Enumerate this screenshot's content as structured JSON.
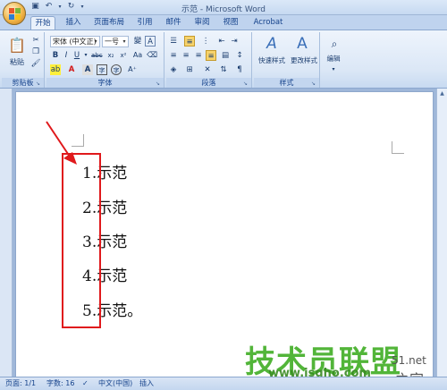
{
  "window": {
    "title": "示范 - Microsoft Word"
  },
  "tabs": [
    {
      "label": "开始",
      "active": true
    },
    {
      "label": "插入"
    },
    {
      "label": "页面布局"
    },
    {
      "label": "引用"
    },
    {
      "label": "邮件"
    },
    {
      "label": "审阅"
    },
    {
      "label": "视图"
    },
    {
      "label": "Acrobat"
    }
  ],
  "ribbon": {
    "clipboard": {
      "paste_label": "粘贴",
      "group_label": "剪贴板"
    },
    "font": {
      "font_name": "宋体 (中文正)",
      "font_size": "一号",
      "group_label": "字体"
    },
    "paragraph": {
      "group_label": "段落"
    },
    "styles": {
      "quick_styles_label": "快速样式",
      "change_styles_label": "更改样式",
      "group_label": "样式"
    },
    "editing": {
      "edit_label": "编辑"
    }
  },
  "document": {
    "list": [
      {
        "number": "1.",
        "text": "示范"
      },
      {
        "number": "2.",
        "text": "示范"
      },
      {
        "number": "3.",
        "text": "示范"
      },
      {
        "number": "4.",
        "text": "示范"
      },
      {
        "number": "5.",
        "text": "示范。"
      }
    ]
  },
  "statusbar": {
    "page": "页面: 1/1",
    "words": "字数: 16",
    "language": "中文(中国)",
    "mode": "插入"
  },
  "watermark": {
    "brand": "技术员联盟",
    "url": "www.jsgho.com",
    "side": "51.net",
    "home": "之家"
  },
  "colors": {
    "annotation_red": "#e0191c",
    "watermark_green": "#49b22f"
  }
}
